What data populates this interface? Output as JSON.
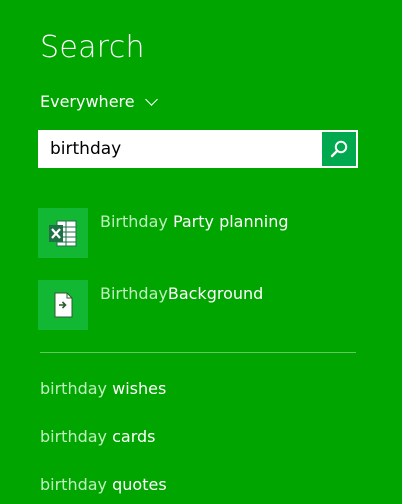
{
  "header": {
    "title": "Search"
  },
  "scope": {
    "label": "Everywhere",
    "icon": "chevron-down-icon"
  },
  "search": {
    "value": "birthday",
    "button_icon": "search-icon"
  },
  "results": [
    {
      "prefix": "Birthday",
      "suffix": "Party planning",
      "separator": " ",
      "icon": "excel-spreadsheet-icon"
    },
    {
      "prefix": "Birthday",
      "suffix": "Background",
      "separator": "",
      "icon": "file-shortcut-icon"
    }
  ],
  "suggestions": [
    {
      "match": "birthday",
      "rest": "wishes"
    },
    {
      "match": "birthday",
      "rest": "cards"
    },
    {
      "match": "birthday",
      "rest": "quotes"
    }
  ],
  "colors": {
    "background": "#00a500",
    "tile": "#12b833",
    "search_button": "#00a94d",
    "dim_text": "#bff0bf",
    "excel_green": "#1e7145"
  }
}
